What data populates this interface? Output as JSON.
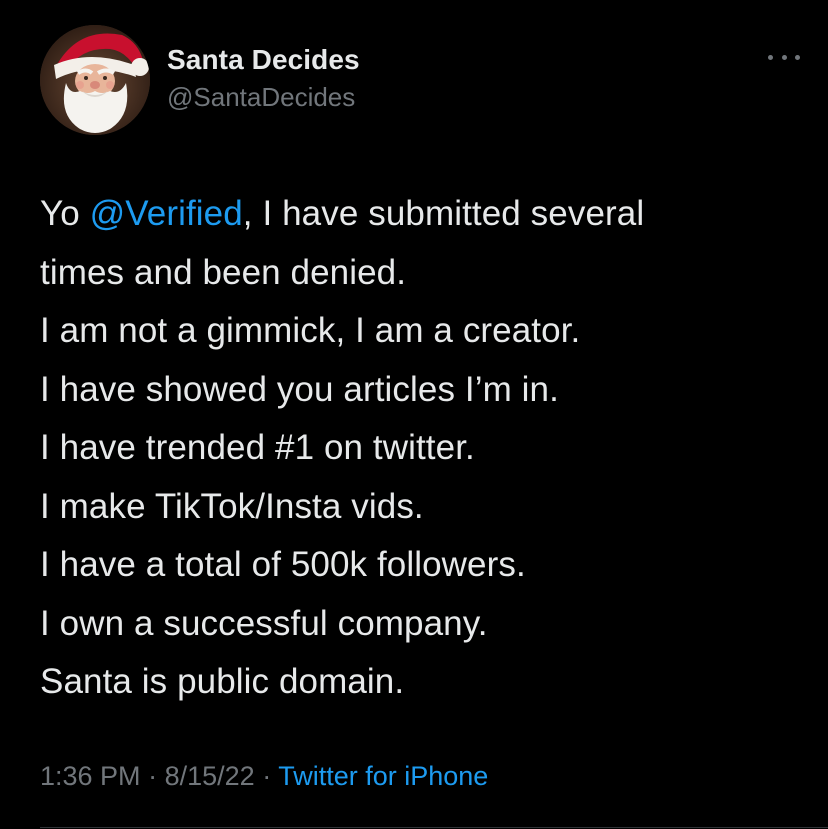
{
  "colors": {
    "background": "#000000",
    "text": "#e7e9ea",
    "secondary": "#71767b",
    "link": "#1d9bf0",
    "divider": "#2f3336"
  },
  "author": {
    "display_name": "Santa Decides",
    "handle": "@SantaDecides",
    "avatar_icon": "santa-avatar"
  },
  "more_icon": "more-horizontal-icon",
  "tweet": {
    "lines": [
      {
        "prefix": "Yo ",
        "mention": "@Verified",
        "suffix": ", I have submitted several"
      },
      "times and been denied.",
      "I am not a gimmick, I am a creator.",
      "I have showed you articles I’m in.",
      "I have trended #1 on twitter.",
      "I make TikTok/Insta vids.",
      "I have a total of 500k followers.",
      "I own a successful company.",
      "Santa is public domain."
    ]
  },
  "meta": {
    "time": "1:36 PM",
    "separator": "·",
    "date": "8/15/22",
    "source": "Twitter for iPhone"
  }
}
